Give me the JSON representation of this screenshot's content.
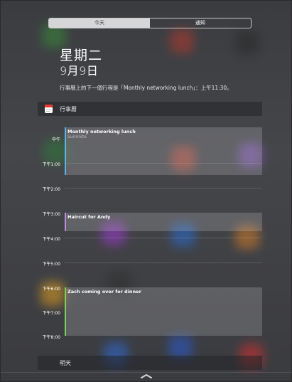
{
  "segmented_control": {
    "tabs": [
      {
        "label": "今天",
        "selected": true
      },
      {
        "label": "通知",
        "selected": false
      }
    ]
  },
  "today": {
    "weekday": "星期二",
    "date": "9月9日",
    "summary": "行事曆上的下一個行程是「Monthly networking lunch」：上午11:30。"
  },
  "calendar_section": {
    "title": "行事曆",
    "icon": "calendar-icon",
    "hours": [
      "中午",
      "下午1:00",
      "下午2:00",
      "下午3:00",
      "下午4:00",
      "下午5:00",
      "下午6:00",
      "下午7:00",
      "下午8:00"
    ],
    "events": [
      {
        "title": "Monthly networking lunch",
        "subtitle": "Sunnnite",
        "color": "#5ab4e8"
      },
      {
        "title": "Haircut for Andy",
        "subtitle": "",
        "color": "#c08ce0"
      },
      {
        "title": "Zach coming over for dinner",
        "subtitle": "",
        "color": "#7ed05a"
      }
    ]
  },
  "tomorrow_section": {
    "title": "明天"
  },
  "grabber": {
    "icon": "chevron-up-icon"
  }
}
